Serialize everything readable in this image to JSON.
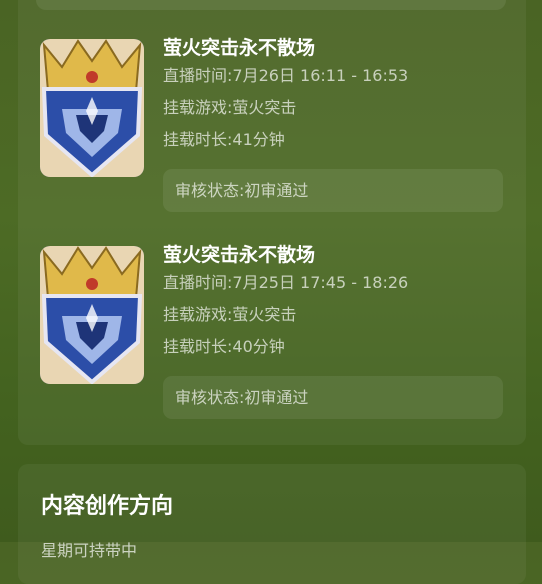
{
  "streams": [
    {
      "title": "萤火突击永不散场",
      "time_label": "直播时间:",
      "time_value": "7月26日 16:11 - 16:53",
      "game_label": "挂载游戏:",
      "game_value": "萤火突击",
      "duration_label": "挂载时长:",
      "duration_value": "41分钟",
      "status_label": "审核状态:",
      "status_value": "初审通过"
    },
    {
      "title": "萤火突击永不散场",
      "time_label": "直播时间:",
      "time_value": "7月25日 17:45 - 18:26",
      "game_label": "挂载游戏:",
      "game_value": "萤火突击",
      "duration_label": "挂载时长:",
      "duration_value": "40分钟",
      "status_label": "审核状态:",
      "status_value": "初审通过"
    }
  ],
  "content_section": {
    "title": "内容创作方向",
    "partial_text": "星期可持带中"
  },
  "colors": {
    "background": "#4a6424",
    "badge_blue": "#2c4ea8",
    "crown_gold": "#e0b94a"
  },
  "icons": {
    "thumbnail": "crown-shield-game-icon"
  }
}
